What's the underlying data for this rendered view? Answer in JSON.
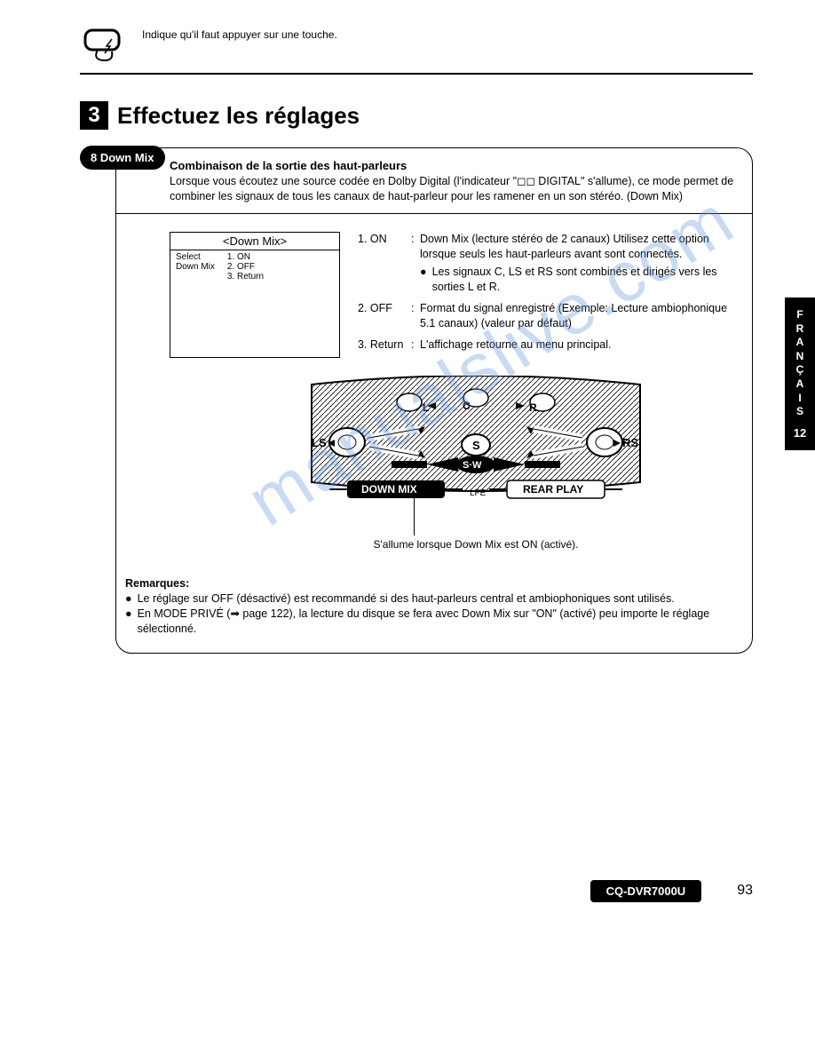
{
  "header": {
    "touch_hint": "Indique qu'il faut appuyer sur une touche."
  },
  "step": {
    "number": "3",
    "title": "Effectuez les réglages"
  },
  "section": {
    "pill": "8 Down Mix",
    "subtitle": "Combinaison de la sortie des haut-parleurs",
    "intro": "Lorsque vous écoutez une source codée en Dolby Digital (l'indicateur \"◻◻ DIGITAL\" s'allume), ce mode permet de combiner les signaux de tous les canaux de haut-parleur pour les ramener en un son stéréo. (Down Mix)"
  },
  "screen": {
    "title": "<Down Mix>",
    "left1": "Select",
    "left2": "Down Mix",
    "right1": "1. ON",
    "right2": "2. OFF",
    "right3": "3. Return"
  },
  "options": {
    "o1_num": "1. ON",
    "o1_body": "Down Mix (lecture stéréo de 2 canaux) Utilisez cette option lorsque seuls les haut-parleurs avant sont connectés.",
    "o1_bullet": "Les signaux C, LS et RS sont combinés et dirigés vers les sorties L et R.",
    "o2_num": "2. OFF",
    "o2_body": "Format du signal enregistré (Exemple: Lecture ambiophonique 5.1 canaux) (valeur par défaut)",
    "o3_num": "3. Return",
    "o3_body": "L'affichage retourne au menu principal."
  },
  "diagram": {
    "labels": {
      "L": "L",
      "C": "C",
      "R": "R",
      "LS": "LS",
      "RS": "RS",
      "S": "S",
      "SW": "S·W",
      "LFE": "LFE",
      "downmix": "DOWN MIX",
      "rearplay": "REAR PLAY"
    },
    "caption": "S'allume lorsque Down Mix est ON (activé)."
  },
  "remarks": {
    "title": "Remarques:",
    "r1": "Le réglage sur OFF (désactivé) est recommandé si des haut-parleurs central et ambiophoniques sont utilisés.",
    "r2": "En MODE PRIVÉ (➡ page 122), la lecture du disque se fera avec Down Mix sur \"ON\" (activé) peu importe le réglage sélectionné."
  },
  "sidebar": {
    "lang": [
      "F",
      "R",
      "A",
      "N",
      "Ç",
      "A",
      "I",
      "S"
    ],
    "page_section": "12"
  },
  "footer": {
    "model": "CQ-DVR7000U",
    "page": "93"
  },
  "watermark": "manualslive.com"
}
